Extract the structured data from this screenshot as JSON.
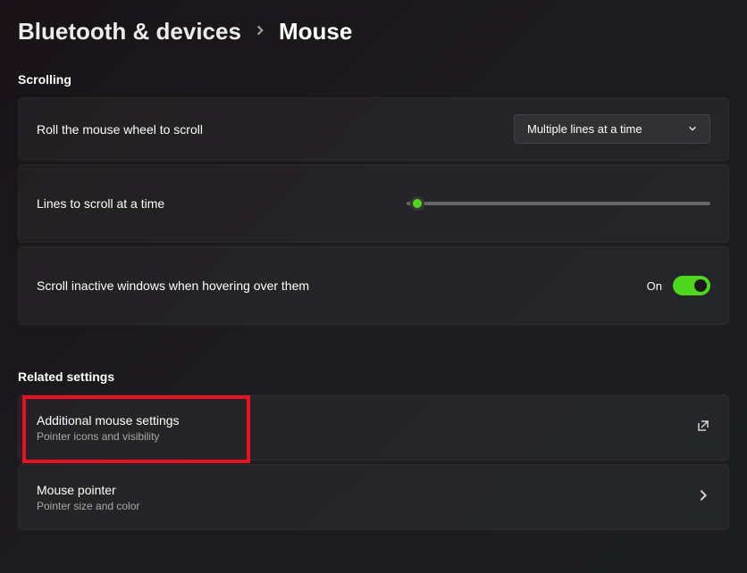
{
  "breadcrumb": {
    "parent": "Bluetooth & devices",
    "current": "Mouse"
  },
  "sections": {
    "scrolling": {
      "header": "Scrolling",
      "roll_wheel": {
        "label": "Roll the mouse wheel to scroll",
        "selected": "Multiple lines at a time"
      },
      "lines_to_scroll": {
        "label": "Lines to scroll at a time"
      },
      "inactive_windows": {
        "label": "Scroll inactive windows when hovering over them",
        "toggle_text": "On"
      }
    },
    "related": {
      "header": "Related settings",
      "additional_mouse": {
        "title": "Additional mouse settings",
        "subtitle": "Pointer icons and visibility"
      },
      "mouse_pointer": {
        "title": "Mouse pointer",
        "subtitle": "Pointer size and color"
      }
    }
  }
}
